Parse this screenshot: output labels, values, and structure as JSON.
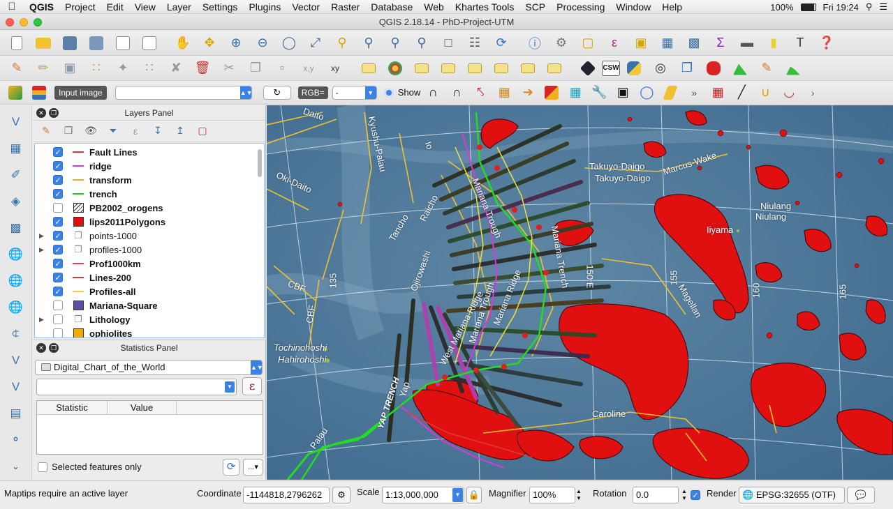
{
  "menubar": {
    "app_name": "QGIS",
    "items": [
      "Project",
      "Edit",
      "View",
      "Layer",
      "Settings",
      "Plugins",
      "Vector",
      "Raster",
      "Database",
      "Web",
      "Khartes Tools",
      "SCP",
      "Processing",
      "Window",
      "Help"
    ],
    "battery": "100%",
    "clock": "Fri 19:24"
  },
  "window": {
    "title": "QGIS 2.18.14 - PhD-Project-UTM"
  },
  "scp_toolbar": {
    "input_image_label": "Input image",
    "input_image_value": "",
    "rgb_label": "RGB=",
    "rgb_value": "-",
    "show_label": "Show"
  },
  "layers_panel": {
    "title": "Layers Panel",
    "layers": [
      {
        "name": "Fault Lines",
        "checked": true,
        "bold": true,
        "symbol": "line",
        "color": "#e03a3a",
        "expandable": false
      },
      {
        "name": "ridge",
        "checked": true,
        "bold": true,
        "symbol": "line",
        "color": "#d63ad6",
        "expandable": false
      },
      {
        "name": "transform",
        "checked": true,
        "bold": true,
        "symbol": "line",
        "color": "#f0b020",
        "expandable": false
      },
      {
        "name": "trench",
        "checked": true,
        "bold": true,
        "symbol": "line",
        "color": "#22cc22",
        "expandable": false
      },
      {
        "name": "PB2002_orogens",
        "checked": false,
        "bold": true,
        "symbol": "hatch",
        "color": "#333333",
        "expandable": false
      },
      {
        "name": "lips2011Polygons",
        "checked": true,
        "bold": true,
        "symbol": "fill",
        "color": "#e01010",
        "expandable": false
      },
      {
        "name": "points-1000",
        "checked": true,
        "bold": false,
        "symbol": "group",
        "color": "#888888",
        "expandable": true
      },
      {
        "name": "profiles-1000",
        "checked": true,
        "bold": false,
        "symbol": "group",
        "color": "#888888",
        "expandable": true
      },
      {
        "name": "Prof1000km",
        "checked": true,
        "bold": true,
        "symbol": "line",
        "color": "#e04040",
        "expandable": false
      },
      {
        "name": "Lines-200",
        "checked": true,
        "bold": true,
        "symbol": "line",
        "color": "#c84040",
        "expandable": false
      },
      {
        "name": "Profiles-all",
        "checked": true,
        "bold": true,
        "symbol": "line",
        "color": "#f0d040",
        "expandable": false
      },
      {
        "name": "Mariana-Square",
        "checked": false,
        "bold": true,
        "symbol": "fill",
        "color": "#5b50a8",
        "expandable": false
      },
      {
        "name": "Lithology",
        "checked": false,
        "bold": true,
        "symbol": "group",
        "color": "#888888",
        "expandable": true
      },
      {
        "name": "ophiolites",
        "checked": false,
        "bold": true,
        "symbol": "fill",
        "color": "#f2a900",
        "expandable": false
      }
    ]
  },
  "statistics_panel": {
    "title": "Statistics Panel",
    "layer": "Digital_Chart_of_the_World",
    "field": "",
    "columns": [
      "Statistic",
      "Value"
    ],
    "selected_only_label": "Selected features only",
    "selected_only": false,
    "more_label": "..."
  },
  "map": {
    "labels": [
      "Daito",
      "Kyushu-Palau",
      "Io",
      "Oki-Daito",
      "Raicho",
      "Mariana Trough",
      "Takuyo-Daigo",
      "Takuyo-Daigo",
      "Marcus-Wake",
      "Niulang",
      "Niulang",
      "Iiyama",
      "Tancho",
      "Ojirowashi",
      "Mariana Trench",
      "150 E",
      "135",
      "155",
      "160",
      "165",
      "CBF",
      "CBF",
      "Magellan",
      "West Mariana Ridge",
      "Mariana Trough",
      "Mariana Ridge",
      "Tochinohoshi",
      "Hahirohoshi",
      "Yap",
      "YAP TRENCH",
      "Palau",
      "Caroline"
    ]
  },
  "statusbar": {
    "message": "Maptips require an active layer",
    "coordinate_label": "Coordinate",
    "coordinate": "-1144818,2796262",
    "scale_label": "Scale",
    "scale": "1:13,000,000",
    "magnifier_label": "Magnifier",
    "magnifier": "100%",
    "rotation_label": "Rotation",
    "rotation": "0.0",
    "render_label": "Render",
    "render": true,
    "crs": "EPSG:32655 (OTF)"
  }
}
